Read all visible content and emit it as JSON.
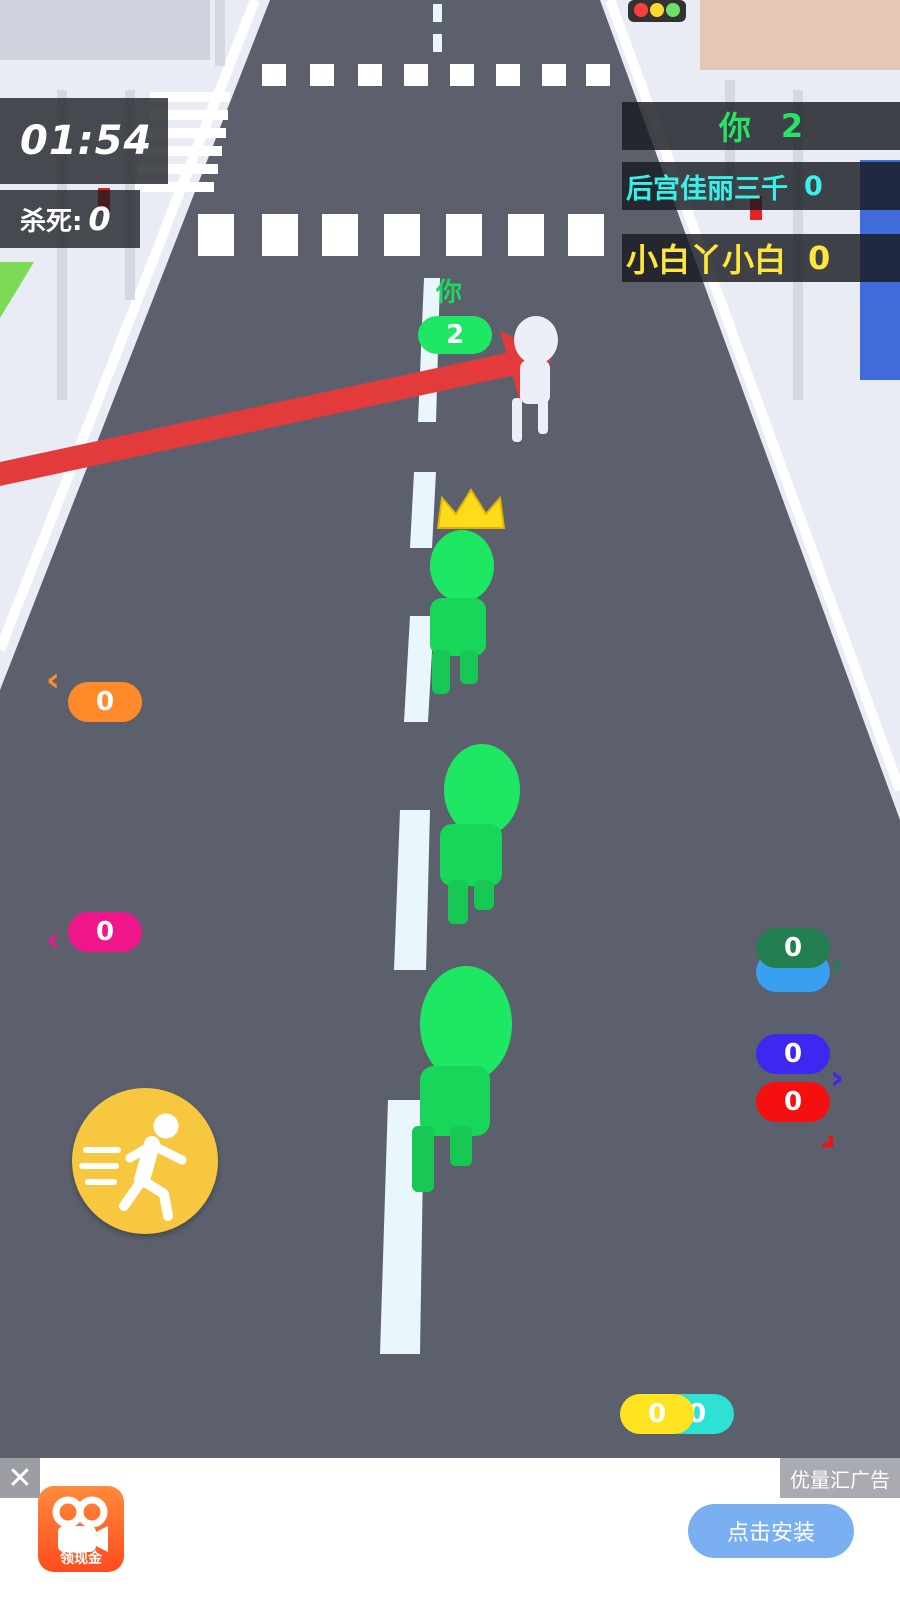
{
  "hud": {
    "timer": "01:54",
    "kills_label": "杀死:",
    "kills_value": "0"
  },
  "leaderboard": [
    {
      "name": "你",
      "score": "2",
      "color": "#24e566"
    },
    {
      "name": "后宫佳丽三千",
      "score": "0",
      "color": "#36f2e8"
    },
    {
      "name": "小白丫小白",
      "score": "0",
      "color": "#ffe63a"
    }
  ],
  "player": {
    "tag": "你",
    "count": "2",
    "color": "#1ee763"
  },
  "offscreen_badges": [
    {
      "id": "orange",
      "value": "0",
      "color": "#ff8a2a"
    },
    {
      "id": "pink",
      "value": "0",
      "color": "#ef168b"
    },
    {
      "id": "green",
      "value": "0",
      "color": "#237f4f"
    },
    {
      "id": "blue",
      "value": "0",
      "color": "#3e27f0"
    },
    {
      "id": "red",
      "value": "0",
      "color": "#f50f0f"
    },
    {
      "id": "cyan",
      "value": "0",
      "color": "#2de1d5"
    },
    {
      "id": "yellow",
      "value": "0",
      "color": "#ffe31f"
    }
  ],
  "crown_icon": "crown-icon",
  "sprint_button": {
    "icon": "running-man-icon",
    "color": "#f8c740"
  },
  "ad": {
    "close_icon": "close-icon",
    "tag": "优量汇广告",
    "app_label": "领现金",
    "install_label": "点击安装"
  }
}
